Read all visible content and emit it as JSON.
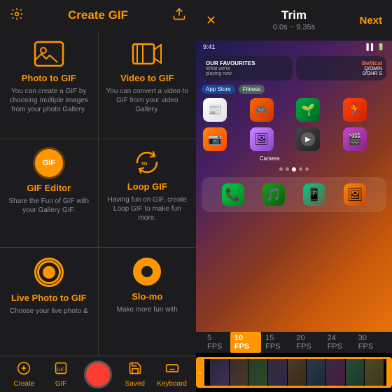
{
  "left": {
    "header": {
      "title": "Create GIF",
      "settings_icon": "⚙",
      "share_icon": "📋"
    },
    "cells": [
      {
        "id": "photo-to-gif",
        "title": "Photo to GIF",
        "desc": "You can create a GIF by choosing multiple images from your photo Gallery.",
        "icon_type": "image"
      },
      {
        "id": "video-to-gif",
        "title": "Video to GIF",
        "desc": "You can convert a video to GIF from your video Gallery.",
        "icon_type": "video"
      },
      {
        "id": "gif-editor",
        "title": "GIF Editor",
        "desc": "Share the Fun of GIF with your Gallery GIF.",
        "icon_type": "gif"
      },
      {
        "id": "loop-gif",
        "title": "Loop GIF",
        "desc": "Having fun on GIF, create Loop GIF to make fun more.",
        "icon_type": "loop"
      },
      {
        "id": "live-photo",
        "title": "Live Photo to GIF",
        "desc": "Choose your live photo &",
        "icon_type": "live"
      },
      {
        "id": "slo-mo",
        "title": "Slo-mo",
        "desc": "Make more fun with",
        "icon_type": "slomo"
      }
    ],
    "nav": {
      "create_label": "Create",
      "gif_label": "GIF",
      "saved_label": "Saved",
      "keyboard_label": "Keyboard"
    }
  },
  "right": {
    "header": {
      "time_range": "0.0s ~ 9.35s",
      "title": "Trim",
      "close_icon": "✕",
      "next_label": "Next"
    },
    "fps_options": [
      "5 FPS",
      "10 FPS",
      "15 FPS",
      "20 FPS",
      "24 FPS",
      "30 FPS"
    ],
    "active_fps": 1
  }
}
